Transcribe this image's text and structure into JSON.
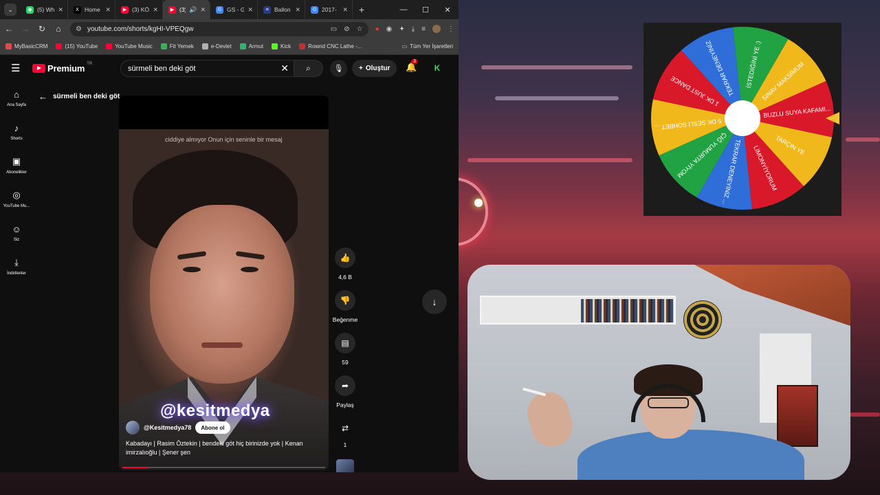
{
  "browser": {
    "tabs": [
      {
        "label": "(5) Wh",
        "fav_color": "#25d366",
        "fav_glyph": "◉",
        "active": false
      },
      {
        "label": "Home",
        "fav_color": "#000000",
        "fav_glyph": "X",
        "active": false
      },
      {
        "label": "(3) KÖ",
        "fav_color": "#ff0033",
        "fav_glyph": "▶",
        "active": false
      },
      {
        "label": "(3)",
        "fav_color": "#ff0033",
        "fav_glyph": "▶",
        "active": true
      },
      {
        "label": "GS - G",
        "fav_color": "#4285f4",
        "fav_glyph": "G",
        "active": false
      },
      {
        "label": "Ballon",
        "fav_color": "#2b3a8a",
        "fav_glyph": "≡",
        "active": false
      },
      {
        "label": "2017-",
        "fav_color": "#4285f4",
        "fav_glyph": "G",
        "active": false
      }
    ],
    "url": "youtube.com/shorts/kgHI-VPEQgw",
    "bookmarks": [
      {
        "label": "MyBasicCRM",
        "color": "#e04a4a"
      },
      {
        "label": "(15) YouTube",
        "color": "#ff0033"
      },
      {
        "label": "YouTube Music",
        "color": "#ff0033"
      },
      {
        "label": "Fit Yemek",
        "color": "#3fae5a"
      },
      {
        "label": "e-Devlet",
        "color": "#b0b0b0"
      },
      {
        "label": "Armut",
        "color": "#2fb36a"
      },
      {
        "label": "Kick",
        "color": "#53fc18"
      },
      {
        "label": "Rownd CNC Lathe -...",
        "color": "#c03030"
      }
    ],
    "bookmarks_all": "Tüm Yer İşaretleri"
  },
  "youtube": {
    "logo": "Premium",
    "logo_region": "TR",
    "search_value": "sürmeli ben deki göt",
    "create_label": "Oluştur",
    "notif_count": "3",
    "user_initial": "K",
    "sidebar": [
      {
        "label": "Ana Sayfa",
        "icon": "⌂"
      },
      {
        "label": "Shorts",
        "icon": "♪"
      },
      {
        "label": "Abonelikler",
        "icon": "▣"
      },
      {
        "label": "YouTube Mu...",
        "icon": "◎"
      },
      {
        "label": "Siz",
        "icon": "☺"
      },
      {
        "label": "İndirilenler",
        "icon": "⤓"
      }
    ],
    "back_title": "sürmeli ben deki göt",
    "short": {
      "overlay_caption": "ciddiye almıyor Onun için seninle bir mesaj",
      "watermark": "@kesitmedya",
      "channel": "@Kesitmedya78",
      "subscribe": "Abone ol",
      "title": "Kabadayı | Rasim Öztekin |  bendeki göt hiç birinizde yok | Kenan imirzalıoğlu | Şener şen",
      "progress": 0.13
    },
    "actions": {
      "likes": "4,6 B",
      "dislike": "Beğenme",
      "comments": "59",
      "share": "Paylaş",
      "remix": "1"
    }
  },
  "wheel": {
    "segments": [
      {
        "label": "SINAV MAKSİMUM",
        "color": "#f1b81c"
      },
      {
        "label": "BUZLU SUYA KAFAMI...",
        "color": "#d9182a"
      },
      {
        "label": "TARÇIN YE",
        "color": "#f1b81c"
      },
      {
        "label": "LİMONYİYORUM",
        "color": "#d9182a"
      },
      {
        "label": "TEKRAR DENEYİNİZ ...",
        "color": "#2f6ed8"
      },
      {
        "label": "ÇİĞ YUMURTA YİYOM",
        "color": "#21a344"
      },
      {
        "label": "5 DK SESLİ SOHBET ...",
        "color": "#f1b81c"
      },
      {
        "label": "1 DK JUST DANCE",
        "color": "#d9182a"
      },
      {
        "label": "TEKRAR DENEYİNİZ",
        "color": "#2f6ed8"
      },
      {
        "label": "İSTEDİĞİNİ YE :)",
        "color": "#21a344"
      }
    ],
    "pointer_color": "#f1c232"
  }
}
